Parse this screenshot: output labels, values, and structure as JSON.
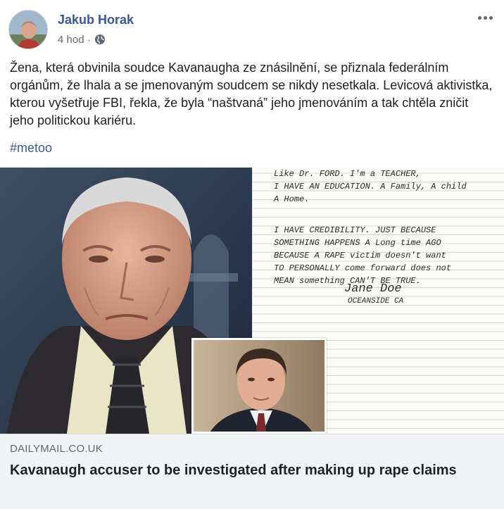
{
  "post": {
    "author": "Jakub Horak",
    "time": "4 hod",
    "separator": "·",
    "privacy_icon": "globe-icon",
    "more_icon": "more-options-icon",
    "text": "Žena, která obvinila soudce Kavanaugha ze znásilnění, se přiznala federálním orgánům, že lhala a se jmenovaným soudcem se nikdy nesetkala. Levicová aktivistka, kterou vyšetřuje FBI, řekla, že byla “naštvaná” jeho jmenováním a tak chtěla zničit jeho politickou kariéru.",
    "hashtag": "#metoo"
  },
  "link": {
    "domain": "DAILYMAIL.CO.UK",
    "title": "Kavanaugh accuser to be investigated after making up rape claims"
  },
  "letter": {
    "lines": [
      "Like Dr. FORD.  I'm a TEACHER,",
      "I HAVE AN EDUCATION.  A Family, A child",
      "A Home.",
      "",
      "I HAVE CREDIBILITY.  JUST BECAUSE",
      "SOMETHING HAPPENS A Long time AGO",
      "BECAUSE A RAPE victim doesn't want",
      "TO PERSONALLY come forward does not",
      "MEAN something CAN'T BE TRUE."
    ],
    "signature": "Jane Doe",
    "place": "OCEANSIDE CA"
  },
  "colors": {
    "link_blue": "#385898",
    "meta_gray": "#616770",
    "footer_bg": "#f2f3f5"
  }
}
